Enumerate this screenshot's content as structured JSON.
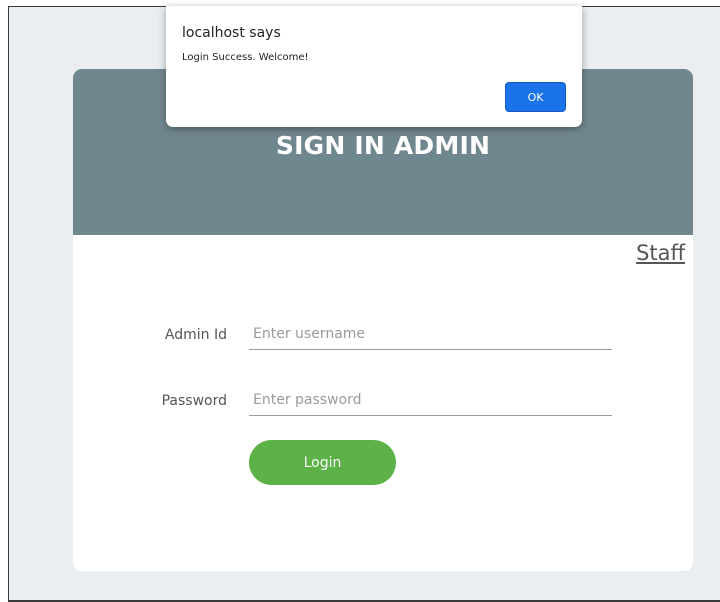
{
  "dialog": {
    "title": "localhost says",
    "message": "Login Success. Welcome!",
    "ok_label": "OK"
  },
  "card": {
    "title": "SIGN IN ADMIN",
    "staff_link": "Staff"
  },
  "form": {
    "admin_id_label": "Admin Id",
    "admin_id_placeholder": "Enter username",
    "admin_id_value": "",
    "password_label": "Password",
    "password_placeholder": "Enter password",
    "password_value": "",
    "login_label": "Login"
  },
  "colors": {
    "header_bg": "#71878f",
    "login_button": "#5cb147",
    "dialog_ok_button": "#1a73e8",
    "page_bg": "#eaeef0"
  }
}
